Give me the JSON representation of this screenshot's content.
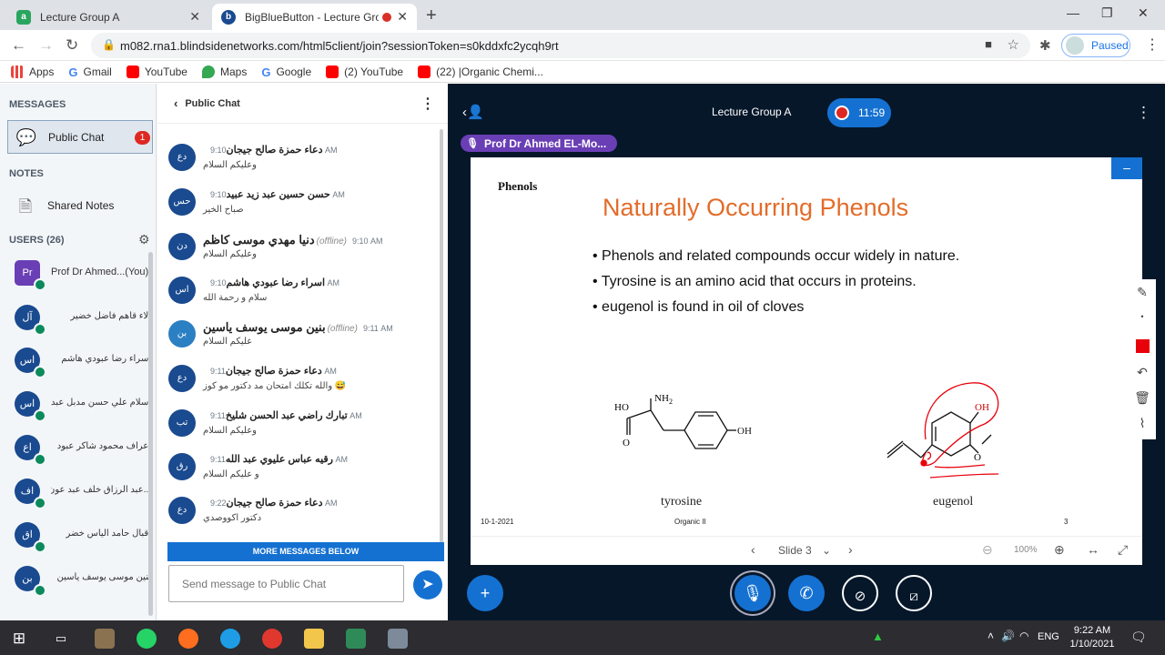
{
  "browser": {
    "tabs": [
      {
        "title": "Lecture Group A",
        "active": false
      },
      {
        "title": "BigBlueButton - Lecture Gro",
        "active": true
      }
    ],
    "url": "m082.rna1.blindsidenetworks.com/html5client/join?sessionToken=s0kddxfc2ycqh9rt",
    "profile_status": "Paused",
    "bookmarks": [
      "Apps",
      "Gmail",
      "YouTube",
      "Maps",
      "Google",
      "(2) YouTube",
      "(22) |Organic Chemi..."
    ]
  },
  "sidebar": {
    "messages_header": "MESSAGES",
    "public_chat_label": "Public Chat",
    "unread_count": "1",
    "notes_header": "NOTES",
    "shared_notes_label": "Shared Notes",
    "users_header": "USERS (26)",
    "users": [
      {
        "initials": "Pr",
        "name": "Prof Dr Ahmed...(You)",
        "presenter": true
      },
      {
        "initials": "آل",
        "name": "آلاء قاهم فاضل خضير"
      },
      {
        "initials": "اس",
        "name": "اسراء رضا عبودي هاشم"
      },
      {
        "initials": "اس",
        "name": "اسلام علي حسن مدبل عبد"
      },
      {
        "initials": "اع",
        "name": "اعراف محمود شاكر عبود"
      },
      {
        "initials": "اف",
        "name": "...عبد الرزاق خلف عبد عون"
      },
      {
        "initials": "اق",
        "name": "اقبال حامد الياس خضر"
      },
      {
        "initials": "بن",
        "name": "بنين موسى يوسف ياسين"
      }
    ]
  },
  "chat": {
    "title": "Public Chat",
    "messages": [
      {
        "initials": "دع",
        "name": "دعاء حمزة صالح جيجان",
        "offline": "",
        "time": "9:10 AM",
        "text": "وعليكم السلام"
      },
      {
        "initials": "حس",
        "name": "حسن حسين عبد زيد عبيد",
        "offline": "",
        "time": "9:10 AM",
        "text": "صباح الخير"
      },
      {
        "initials": "دن",
        "name": "دنيا مهدي موسى كاظم",
        "offline": "(offline)",
        "time": "9:10 AM",
        "text": "وعليكم السلام"
      },
      {
        "initials": "اس",
        "name": "اسراء رضا عبودي هاشم",
        "offline": "",
        "time": "9:10 AM",
        "text": "سلام و رحمة الله"
      },
      {
        "initials": "بن",
        "name": "بنين موسى يوسف ياسين",
        "offline": "(offline)",
        "time": "9:11 AM",
        "text": "عليكم السلام"
      },
      {
        "initials": "دع",
        "name": "دعاء حمزة صالح جيجان",
        "offline": "",
        "time": "9:11 AM",
        "text": "والله تكلك امتحان مد دكتور مو كوز 😅"
      },
      {
        "initials": "تب",
        "name": "تبارك راضي عبد الحسن شليخ",
        "offline": "",
        "time": "9:11 AM",
        "text": "وعليكم السلام"
      },
      {
        "initials": "رق",
        "name": "رقيه عباس عليوي عبد الله",
        "offline": "",
        "time": "9:11 AM",
        "text": "و عليكم السلام"
      },
      {
        "initials": "دع",
        "name": "دعاء حمزة صالح جيجان",
        "offline": "",
        "time": "9:22 AM",
        "text": "دكتور اكووصدي"
      }
    ],
    "more_messages": "MORE MESSAGES BELOW",
    "input_placeholder": "Send message to Public Chat"
  },
  "presentation": {
    "meeting_title": "Lecture Group A",
    "recording_time": "11:59",
    "talking": "Prof Dr Ahmed EL-Mo...",
    "slide": {
      "corner_label": "Phenols",
      "title": "Naturally Occurring Phenols",
      "bullets": [
        "Phenols and related compounds occur widely in nature.",
        "Tyrosine is an amino acid that occurs in proteins.",
        "eugenol is found in oil of cloves"
      ],
      "mol1_label": "tyrosine",
      "mol2_label": "eugenol",
      "chem_ho": "HO",
      "chem_nh": "NH",
      "chem_2": "2",
      "chem_o": "O",
      "chem_oh": "OH",
      "footer_date": "10-1-2021",
      "footer_course": "Organic II",
      "footer_page": "3"
    },
    "slide_nav_label": "Slide 3",
    "zoom": "100%",
    "annotation_color": "#e8000b"
  },
  "taskbar": {
    "language": "ENG",
    "time": "9:22 AM",
    "date": "1/10/2021"
  }
}
